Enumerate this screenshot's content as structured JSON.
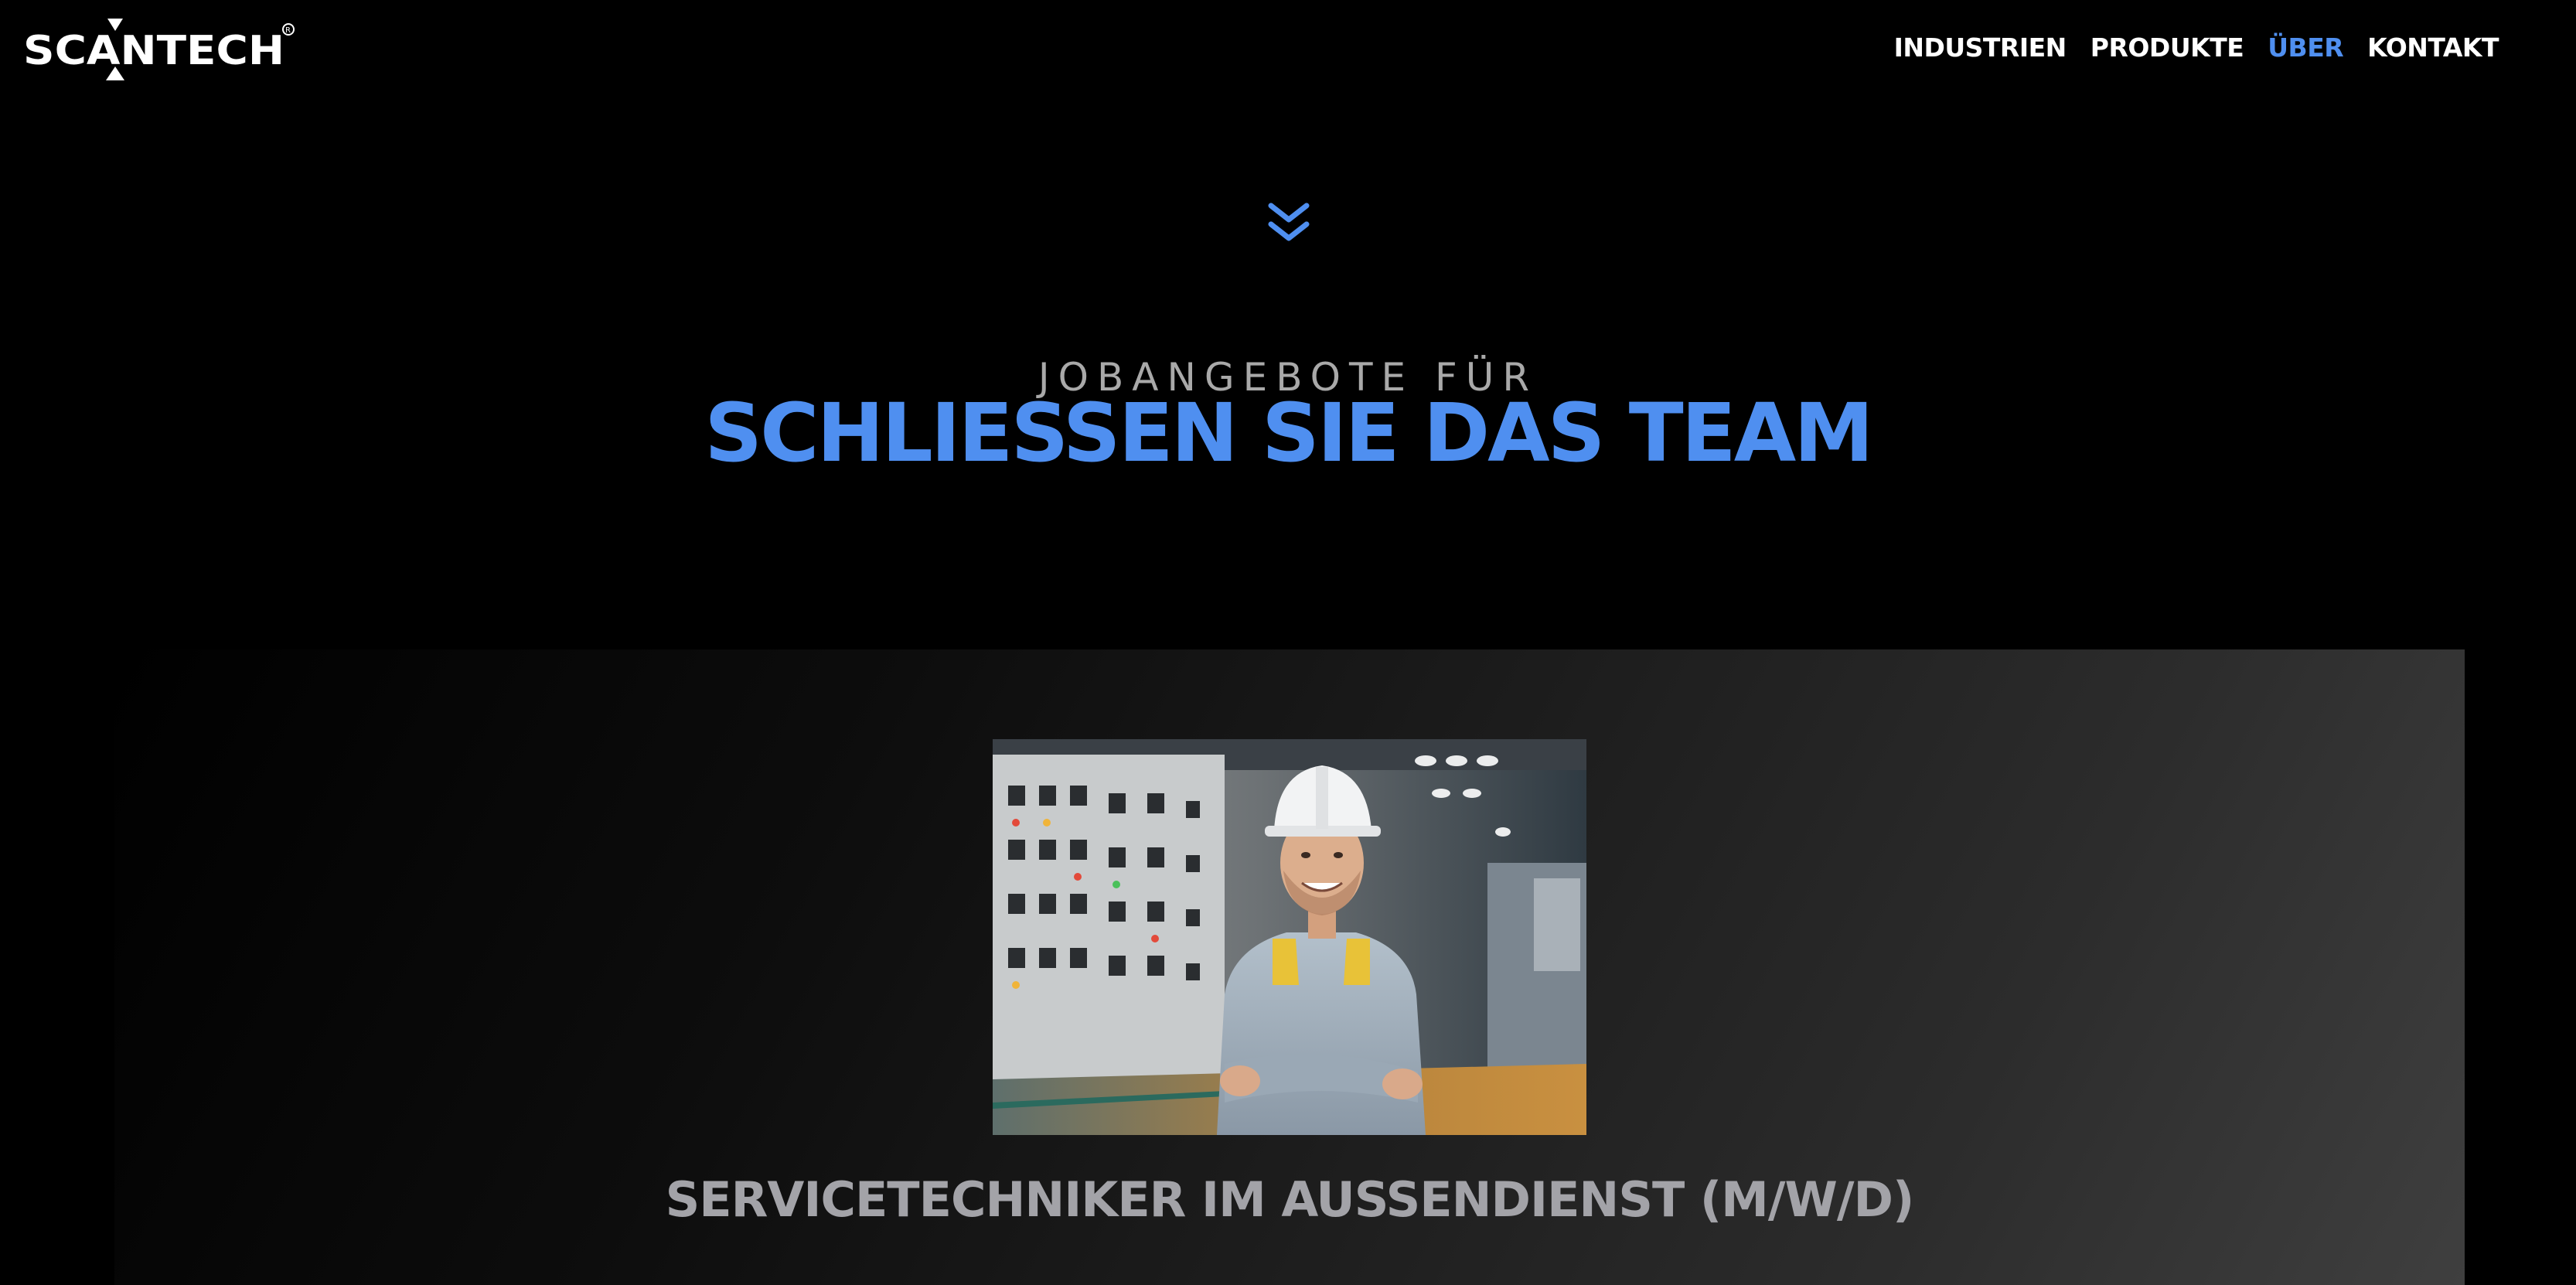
{
  "brand": {
    "name": "SCANTECH",
    "registered_mark": "®"
  },
  "nav": {
    "items": [
      {
        "label": "INDUSTRIEN",
        "active": false
      },
      {
        "label": "PRODUKTE",
        "active": false
      },
      {
        "label": "ÜBER",
        "active": true
      },
      {
        "label": "KONTAKT",
        "active": false
      }
    ]
  },
  "scroll_indicator": {
    "icon": "double-chevron-down-icon"
  },
  "hero": {
    "eyebrow": "JOBANGEBOTE FÜR",
    "title": "SCHLIESSEN SIE DAS TEAM"
  },
  "job": {
    "image_subject": "worker-in-hard-hat-photo",
    "title": "SERVICETECHNIKER IM AUSSENDIENST (M/W/D)"
  },
  "colors": {
    "background": "#000000",
    "accent": "#4f8ff0",
    "nav_text": "#ffffff",
    "eyebrow": "#a9a9a9",
    "job_title": "#a3a3a8"
  }
}
